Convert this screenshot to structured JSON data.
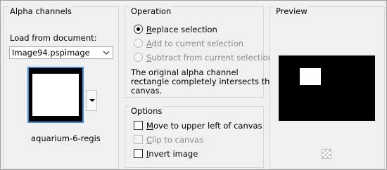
{
  "alpha_channels": {
    "title": "Alpha channels",
    "load_label": "Load from document:",
    "document_select": "Image94.pspimage",
    "thumbnail_caption": "aquarium-6-regis"
  },
  "operation": {
    "title": "Operation",
    "options": [
      {
        "label": "Replace selection",
        "checked": true,
        "enabled": true
      },
      {
        "label": "Add to current selection",
        "checked": false,
        "enabled": false
      },
      {
        "label": "Subtract from current selection",
        "checked": false,
        "enabled": false
      }
    ],
    "info_lines": [
      "The original alpha channel",
      "rectangle completely intersects the",
      "canvas."
    ]
  },
  "options_group": {
    "title": "Options",
    "checks": [
      {
        "label": "Move to upper left of canvas",
        "checked": false,
        "enabled": true
      },
      {
        "label": "Clip to canvas",
        "checked": false,
        "enabled": false
      },
      {
        "label": "Invert image",
        "checked": false,
        "enabled": true
      }
    ]
  },
  "preview": {
    "title": "Preview",
    "icon": "checker-icon"
  },
  "colors": {
    "preview_bg": "#000000",
    "accent": "#3c8ddb"
  }
}
